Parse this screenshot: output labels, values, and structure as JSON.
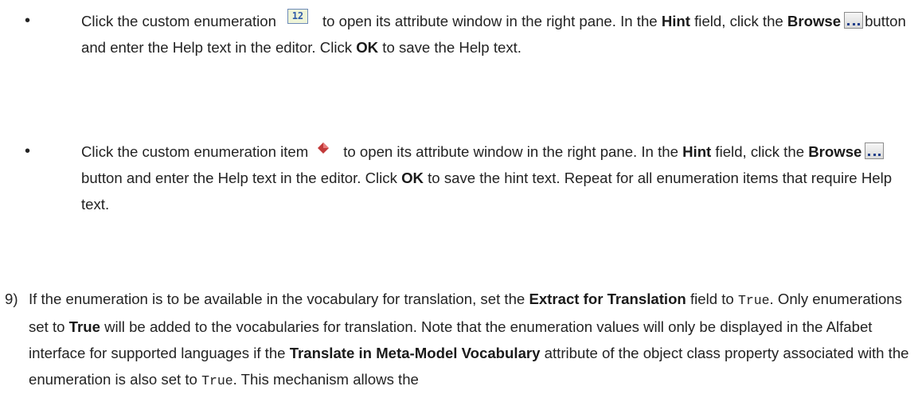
{
  "bullets": [
    {
      "p1": "Click the custom enumeration",
      "p2": "to open its attribute window in the right pane. In the",
      "hint": "Hint",
      "p3": "field, click the",
      "browse": "Browse",
      "p4": "button and enter the Help text in the editor. Click",
      "ok": "OK",
      "p5": "to save the Help text.",
      "icon": "enumeration-icon",
      "icon_text": "12"
    },
    {
      "p1": "Click the custom enumeration item",
      "p2": "to open its attribute window in the right pane. In the",
      "hint": "Hint",
      "p3": "field, click the",
      "browse": "Browse",
      "p4": "button and enter the Help text in the editor. Click",
      "ok": "OK",
      "p5": "to save the hint text. Repeat for all enumeration items that require Help text.",
      "icon": "enumeration-item-icon"
    }
  ],
  "step9": {
    "marker": "9)",
    "t1": "If the enumeration is to be available in the vocabulary for translation, set the",
    "extract": "Extract for Translation",
    "t2": "field to",
    "code1": "True",
    "t3": ". Only enumerations set to",
    "true_bold": "True",
    "t4": "will be added to the vocabularies for translation. Note that the enumeration values will only be displayed in the Alfabet interface for supported languages if the",
    "translate": "Translate in Meta-Model Vocabulary",
    "t5": "attribute of the object class property associated with the enumeration is also set to",
    "code2": "True",
    "t6": ". This mechanism allows the"
  },
  "colors": {
    "text": "#232323",
    "icon_border": "#6c8ab8",
    "diamond": "#c23a3a"
  }
}
